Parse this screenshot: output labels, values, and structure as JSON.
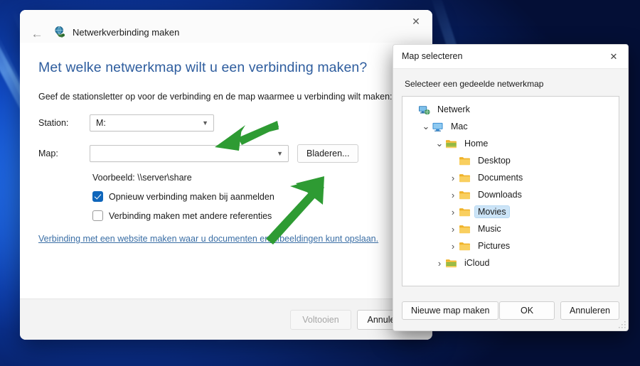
{
  "wizard": {
    "app_name": "Netwerkverbinding maken",
    "app_icon": "network-drive-icon",
    "back_icon": "back-arrow-icon",
    "close_icon": "close-icon",
    "heading": "Met welke netwerkmap wilt u een verbinding maken?",
    "subtext": "Geef de stationsletter op voor de verbinding en de map waarmee u verbinding wilt maken:",
    "station_label": "Station:",
    "station_value": "M:",
    "map_label": "Map:",
    "map_value": "",
    "map_placeholder": "",
    "browse_button": "Bladeren...",
    "example_text": "Voorbeeld: \\\\server\\share",
    "checkbox_reconnect": "Opnieuw verbinding maken bij aanmelden",
    "checkbox_reconnect_checked": true,
    "checkbox_credentials": "Verbinding maken met andere referenties",
    "checkbox_credentials_checked": false,
    "web_link": "Verbinding met een website maken waar u documenten en afbeeldingen kunt opslaan.",
    "finish_button": "Voltooien",
    "cancel_button": "Annuleren"
  },
  "picker": {
    "title": "Map selecteren",
    "close_icon": "close-icon",
    "prompt": "Selecteer een gedeelde netwerkmap",
    "tree": [
      {
        "label": "Netwerk",
        "icon": "network-computer-icon",
        "indent": 0,
        "twisty": "",
        "selected": false
      },
      {
        "label": "Mac",
        "icon": "computer-icon",
        "indent": 1,
        "twisty": "v",
        "selected": false
      },
      {
        "label": "Home",
        "icon": "shared-folder-icon",
        "indent": 2,
        "twisty": "v",
        "selected": false
      },
      {
        "label": "Desktop",
        "icon": "folder-icon",
        "indent": 3,
        "twisty": "",
        "selected": false
      },
      {
        "label": "Documents",
        "icon": "folder-icon",
        "indent": 3,
        "twisty": ">",
        "selected": false
      },
      {
        "label": "Downloads",
        "icon": "folder-icon",
        "indent": 3,
        "twisty": ">",
        "selected": false
      },
      {
        "label": "Movies",
        "icon": "folder-icon",
        "indent": 3,
        "twisty": ">",
        "selected": true
      },
      {
        "label": "Music",
        "icon": "folder-icon",
        "indent": 3,
        "twisty": ">",
        "selected": false
      },
      {
        "label": "Pictures",
        "icon": "folder-icon",
        "indent": 3,
        "twisty": ">",
        "selected": false
      },
      {
        "label": "iCloud",
        "icon": "shared-folder-icon",
        "indent": 2,
        "twisty": ">",
        "selected": false
      }
    ],
    "new_folder_button": "Nieuwe map maken",
    "ok_button": "OK",
    "cancel_button": "Annuleren",
    "resize_grip_icon": "resize-grip-icon"
  },
  "annotations": {
    "color": "#2e9b33",
    "arrows": [
      {
        "name": "arrow-pointing-to-station-dropdown"
      },
      {
        "name": "arrow-pointing-to-browse-button"
      },
      {
        "name": "arrow-pointing-to-folder-tree"
      }
    ]
  },
  "colors": {
    "accent": "#0f66bb",
    "heading": "#2e5d9e",
    "link": "#3a6ea5",
    "selection": "#cce4f7",
    "annotation_green": "#2e9b33",
    "folder_yellow": "#f7c245",
    "shared_folder_green": "#78b43c"
  }
}
